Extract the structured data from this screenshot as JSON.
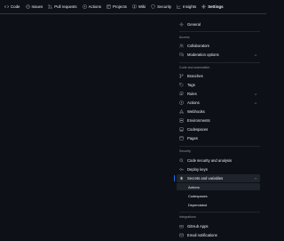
{
  "topnav": {
    "tabs": [
      {
        "label": "Code",
        "icon": "code-icon"
      },
      {
        "label": "Issues",
        "icon": "issue-opened-icon"
      },
      {
        "label": "Pull requests",
        "icon": "git-pull-request-icon"
      },
      {
        "label": "Actions",
        "icon": "play-icon"
      },
      {
        "label": "Projects",
        "icon": "table-icon"
      },
      {
        "label": "Wiki",
        "icon": "book-icon"
      },
      {
        "label": "Security",
        "icon": "shield-icon"
      },
      {
        "label": "Insights",
        "icon": "graph-icon"
      },
      {
        "label": "Settings",
        "icon": "gear-icon"
      }
    ],
    "selected": "Settings"
  },
  "sidebar": {
    "general": "General",
    "access_heading": "Access",
    "collaborators": "Collaborators",
    "moderation": "Moderation options",
    "code_heading": "Code and automation",
    "branches": "Branches",
    "tags": "Tags",
    "rules": "Rules",
    "actions": "Actions",
    "webhooks": "Webhooks",
    "environments": "Environments",
    "codespaces": "Codespaces",
    "pages": "Pages",
    "security_heading": "Security",
    "code_security": "Code security and analysis",
    "deploy_keys": "Deploy keys",
    "secrets": "Secrets and variables",
    "secrets_sub": [
      "Actions",
      "Codespaces",
      "Dependabot"
    ],
    "integrations_heading": "Integrations",
    "github_apps": "GitHub Apps",
    "email_notifications": "Email notifications"
  },
  "colors": {
    "background": "#0d1117",
    "accent_underline": "#f78166",
    "active_marker": "#1f6feb",
    "muted_text": "#8d96a0"
  }
}
